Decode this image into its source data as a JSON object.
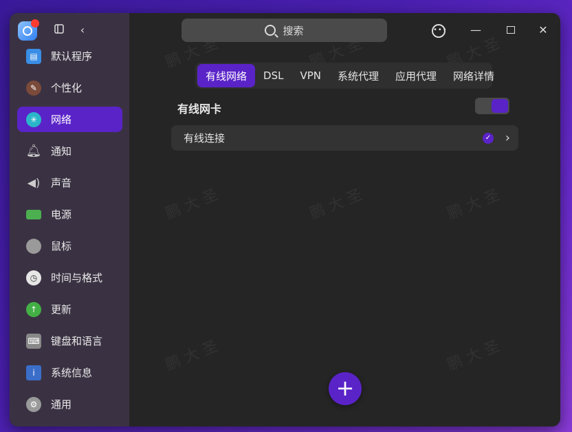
{
  "search": {
    "placeholder": "搜索"
  },
  "sidebar": {
    "items": [
      {
        "label": "默认程序",
        "icon": "default-apps-icon",
        "color": "#3a8ee6"
      },
      {
        "label": "个性化",
        "icon": "personalization-icon",
        "color": "#7a4a3a"
      },
      {
        "label": "网络",
        "icon": "network-icon",
        "color": "#2bb5c9",
        "active": true
      },
      {
        "label": "通知",
        "icon": "bell-icon",
        "color": "#bdbdbd"
      },
      {
        "label": "声音",
        "icon": "speaker-icon",
        "color": "#bdbdbd"
      },
      {
        "label": "电源",
        "icon": "battery-icon",
        "color": "#4caf50"
      },
      {
        "label": "鼠标",
        "icon": "mouse-icon",
        "color": "#9a9a9a"
      },
      {
        "label": "时间与格式",
        "icon": "clock-icon",
        "color": "#e6e6e6"
      },
      {
        "label": "更新",
        "icon": "update-icon",
        "color": "#43b045"
      },
      {
        "label": "键盘和语言",
        "icon": "keyboard-icon",
        "color": "#888888"
      },
      {
        "label": "系统信息",
        "icon": "system-info-icon",
        "color": "#3a6ec9"
      },
      {
        "label": "通用",
        "icon": "general-settings-icon",
        "color": "#9a9a9a"
      }
    ]
  },
  "tabs": [
    {
      "label": "有线网络",
      "active": true
    },
    {
      "label": "DSL"
    },
    {
      "label": "VPN"
    },
    {
      "label": "系统代理"
    },
    {
      "label": "应用代理"
    },
    {
      "label": "网络详情"
    }
  ],
  "wired": {
    "title": "有线网卡",
    "enabled": true,
    "connection_label": "有线连接",
    "connected": true
  },
  "colors": {
    "accent": "#5a23c8"
  },
  "watermark": {
    "text": "鹏 大 圣"
  }
}
